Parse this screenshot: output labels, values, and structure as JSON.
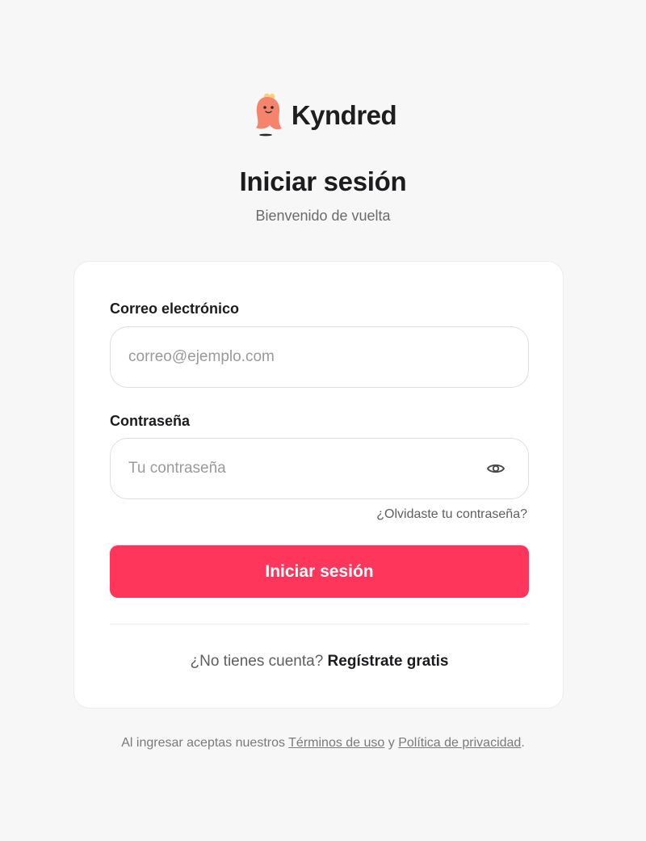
{
  "brand": {
    "name": "Kyndred",
    "logo_icon": "ghost-mascot-icon",
    "colors": {
      "mascot_body": "#f4846b",
      "mascot_tuft": "#f7d27a",
      "accent": "#ff365c"
    }
  },
  "header": {
    "title": "Iniciar sesión",
    "subtitle": "Bienvenido de vuelta"
  },
  "form": {
    "email": {
      "label": "Correo electrónico",
      "value": "",
      "placeholder": "correo@ejemplo.com"
    },
    "password": {
      "label": "Contraseña",
      "value": "",
      "placeholder": "Tu contraseña",
      "toggle_icon": "eye-icon"
    },
    "forgot_label": "¿Olvidaste tu contraseña?",
    "submit_label": "Iniciar sesión"
  },
  "signup": {
    "prompt": "¿No tienes cuenta?",
    "link_label": "Regístrate gratis"
  },
  "legal": {
    "prefix": "Al ingresar aceptas nuestros",
    "terms_label": "Términos de uso",
    "conjunction": "y",
    "privacy_label": "Política de privacidad",
    "suffix": "."
  }
}
